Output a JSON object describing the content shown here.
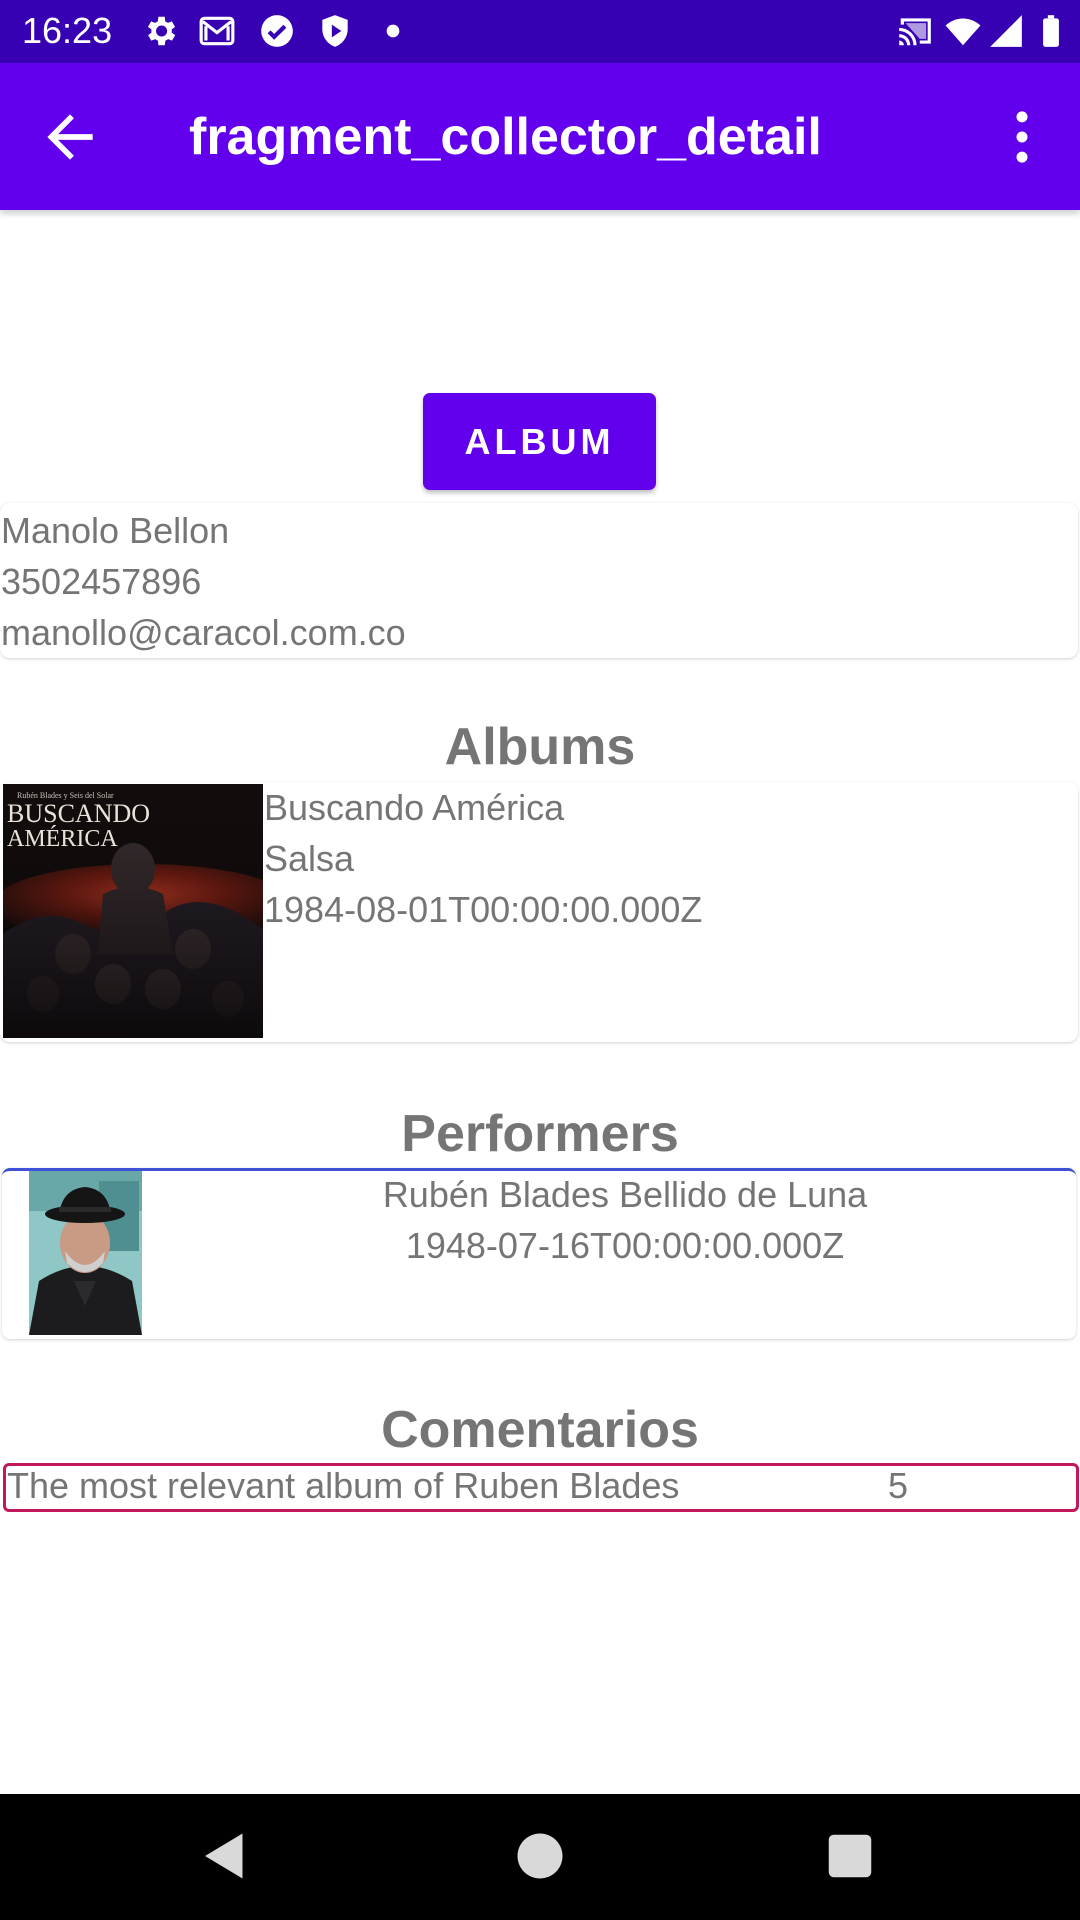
{
  "status_bar": {
    "time": "16:23",
    "left_icons": [
      "gear-icon",
      "gmail-icon",
      "check-circle-icon",
      "shield-icon",
      "dot-icon"
    ],
    "right_icons": [
      "cast-icon",
      "wifi-icon",
      "signal-icon",
      "battery-icon"
    ],
    "background": "#3700b3"
  },
  "app_bar": {
    "title": "fragment_collector_detail",
    "background": "#6200ee"
  },
  "album_button": {
    "label": "ALBUM"
  },
  "collector": {
    "name": "Manolo Bellon",
    "phone": "3502457896",
    "email": "manollo@caracol.com.co"
  },
  "sections": {
    "albums_title": "Albums",
    "performers_title": "Performers",
    "comments_title": "Comentarios"
  },
  "albums": [
    {
      "name": "Buscando América",
      "genre": "Salsa",
      "release_date": "1984-08-01T00:00:00.000Z",
      "cover_text_line1": "BUSCANDO",
      "cover_text_line2": "AMÉRICA",
      "cover_small_text": "Rubén Blades y Seis del Solar"
    }
  ],
  "performers": [
    {
      "name": "Rubén Blades Bellido de Luna",
      "birth_date": "1948-07-16T00:00:00.000Z"
    }
  ],
  "comments": [
    {
      "description": "The most relevant album of Ruben Blades",
      "rating": "5"
    }
  ],
  "nav_bar": {
    "buttons": [
      "back-triangle-icon",
      "home-circle-icon",
      "recents-square-icon"
    ]
  },
  "colors": {
    "primary": "#6200ee",
    "primary_dark": "#3700b3",
    "performer_accent": "#3f51d6",
    "comment_accent": "#c2185b",
    "text_gray": "#757575"
  }
}
